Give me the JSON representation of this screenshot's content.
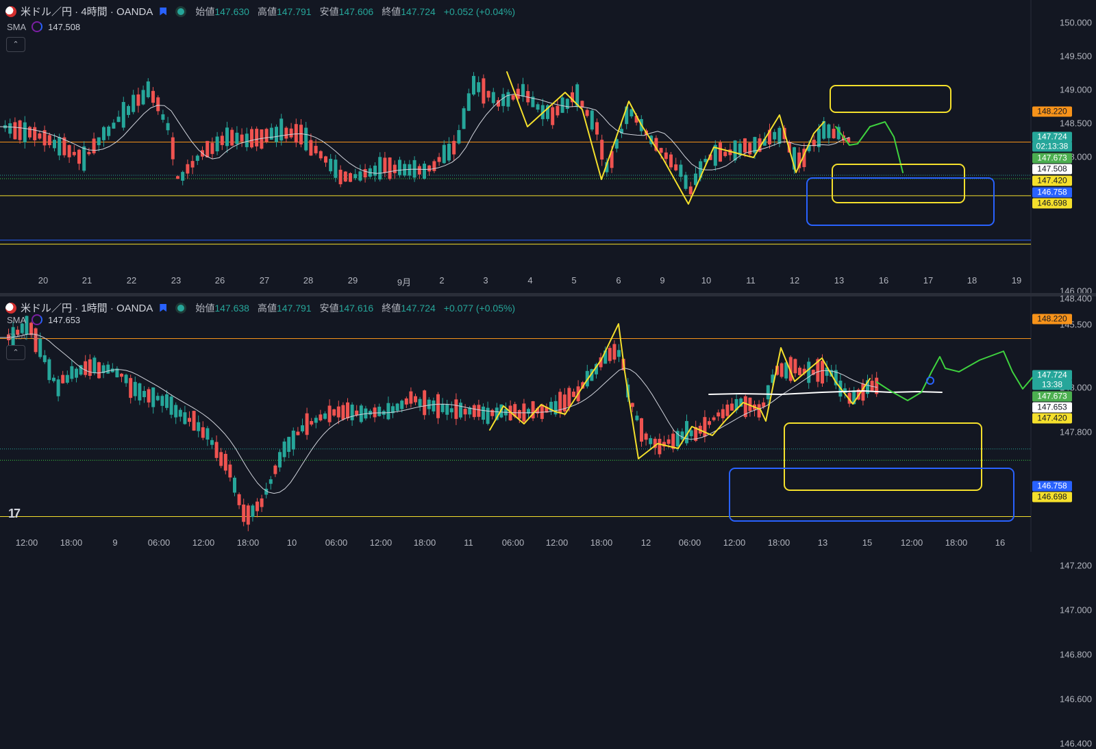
{
  "colors": {
    "background": "#131722",
    "up": "#26a69a",
    "down": "#ef5350",
    "orange": "#f7931a",
    "yellow": "#f5e02c",
    "blue": "#2962ff",
    "green": "#3fd33f",
    "sma": "#d1d4dc"
  },
  "pane1": {
    "title": "米ドル／円 · 4時間 · OANDA",
    "ohlc": [
      {
        "k": "始値",
        "v": "147.630"
      },
      {
        "k": "高値",
        "v": "147.791"
      },
      {
        "k": "安値",
        "v": "147.606"
      },
      {
        "k": "終値",
        "v": "147.724"
      }
    ],
    "change": "+0.052 (+0.04%)",
    "sma_label": "SMA",
    "sma_value": "147.508",
    "collapse_icon": "chevron-up-icon",
    "y_ticks": [
      "150.000",
      "149.500",
      "149.000",
      "148.500",
      "148.000",
      "146.000",
      "145.500"
    ],
    "x_ticks": [
      "20",
      "21",
      "22",
      "23",
      "26",
      "27",
      "28",
      "29",
      "9月",
      "2",
      "3",
      "4",
      "5",
      "6",
      "9",
      "10",
      "11",
      "12",
      "13",
      "16",
      "17",
      "18",
      "19"
    ],
    "price_tags": [
      {
        "text": "148.220",
        "bg": "#f7931a",
        "fg": "#131722"
      },
      {
        "text": "147.724",
        "bg": "#26a69a",
        "fg": "#ffffff"
      },
      {
        "text": "02:13:38",
        "bg": "#26a69a",
        "fg": "#ffffff"
      },
      {
        "text": "147.673",
        "bg": "#4caf50",
        "fg": "#ffffff"
      },
      {
        "text": "147.508",
        "bg": "#ffffff",
        "fg": "#131722"
      },
      {
        "text": "147.420",
        "bg": "#f5e02c",
        "fg": "#131722"
      },
      {
        "text": "146.758",
        "bg": "#2962ff",
        "fg": "#ffffff"
      },
      {
        "text": "146.698",
        "bg": "#f5e02c",
        "fg": "#131722"
      }
    ]
  },
  "pane2": {
    "title": "米ドル／円 · 1時間 · OANDA",
    "ohlc": [
      {
        "k": "始値",
        "v": "147.638"
      },
      {
        "k": "高値",
        "v": "147.791"
      },
      {
        "k": "安値",
        "v": "147.616"
      },
      {
        "k": "終値",
        "v": "147.724"
      }
    ],
    "change": "+0.077 (+0.05%)",
    "sma_label": "SMA",
    "sma_value": "147.653",
    "sma2_label": "SMA",
    "collapse_icon": "chevron-up-icon",
    "y_ticks": [
      "148.400",
      "148.000",
      "147.800",
      "147.200",
      "147.000",
      "146.800",
      "146.600",
      "146.400"
    ],
    "x_ticks": [
      "12:00",
      "18:00",
      "9",
      "06:00",
      "12:00",
      "18:00",
      "10",
      "06:00",
      "12:00",
      "18:00",
      "11",
      "06:00",
      "12:00",
      "18:00",
      "12",
      "06:00",
      "12:00",
      "18:00",
      "13",
      "15",
      "12:00",
      "18:00",
      "16"
    ],
    "price_tags": [
      {
        "text": "148.220",
        "bg": "#f7931a",
        "fg": "#131722"
      },
      {
        "text": "147.724",
        "bg": "#26a69a",
        "fg": "#ffffff"
      },
      {
        "text": "13:38",
        "bg": "#26a69a",
        "fg": "#ffffff"
      },
      {
        "text": "147.673",
        "bg": "#4caf50",
        "fg": "#ffffff"
      },
      {
        "text": "147.653",
        "bg": "#ffffff",
        "fg": "#131722"
      },
      {
        "text": "147.420",
        "bg": "#f5e02c",
        "fg": "#131722"
      },
      {
        "text": "146.758",
        "bg": "#2962ff",
        "fg": "#ffffff"
      },
      {
        "text": "146.698",
        "bg": "#f5e02c",
        "fg": "#131722"
      }
    ]
  },
  "logo": "17"
}
